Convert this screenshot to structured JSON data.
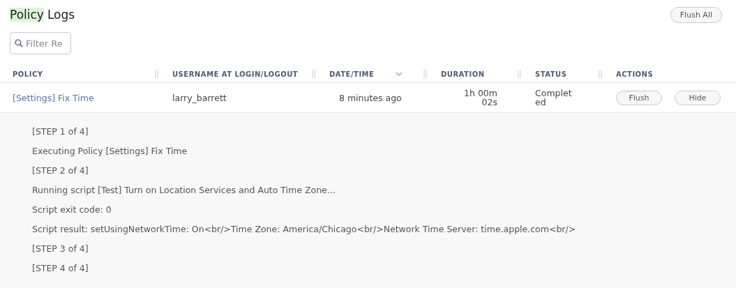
{
  "title": [
    {
      "text": "Policy",
      "highlighted": true
    },
    {
      "text": "Logs",
      "highlighted": false
    }
  ],
  "toolbar": {
    "button": "Flush All"
  },
  "filter": {
    "placeholder": "Filter Re"
  },
  "table": {
    "columns": [
      {
        "label": "POLICY",
        "sorted": false
      },
      {
        "label": "USERNAME AT LOGIN/LOGOUT",
        "sorted": false
      },
      {
        "label": "DATE/TIME",
        "sorted": true
      },
      {
        "label": "DURATION",
        "sorted": false
      },
      {
        "label": "STATUS",
        "sorted": false
      },
      {
        "label": "ACTIONS",
        "sorted": false
      }
    ],
    "rows": [
      {
        "policy": "[Settings] Fix Time",
        "username": "larry_barrett",
        "datetime": "8 minutes ago",
        "duration": "1h 00m 02s",
        "status": "Completed",
        "actions": [
          "Flush",
          "Hide"
        ],
        "expanded": true,
        "log": [
          "[STEP 1 of 4]",
          "Executing Policy [Settings] Fix Time",
          "[STEP 2 of 4]",
          "Running script [Test] Turn on Location Services and Auto Time Zone...",
          "Script exit code: 0",
          "Script result: setUsingNetworkTime: On<br/>Time Zone: America/Chicago<br/>Network Time Server: time.apple.com<br/>",
          "[STEP 3 of 4]",
          "[STEP 4 of 4]"
        ]
      }
    ]
  }
}
